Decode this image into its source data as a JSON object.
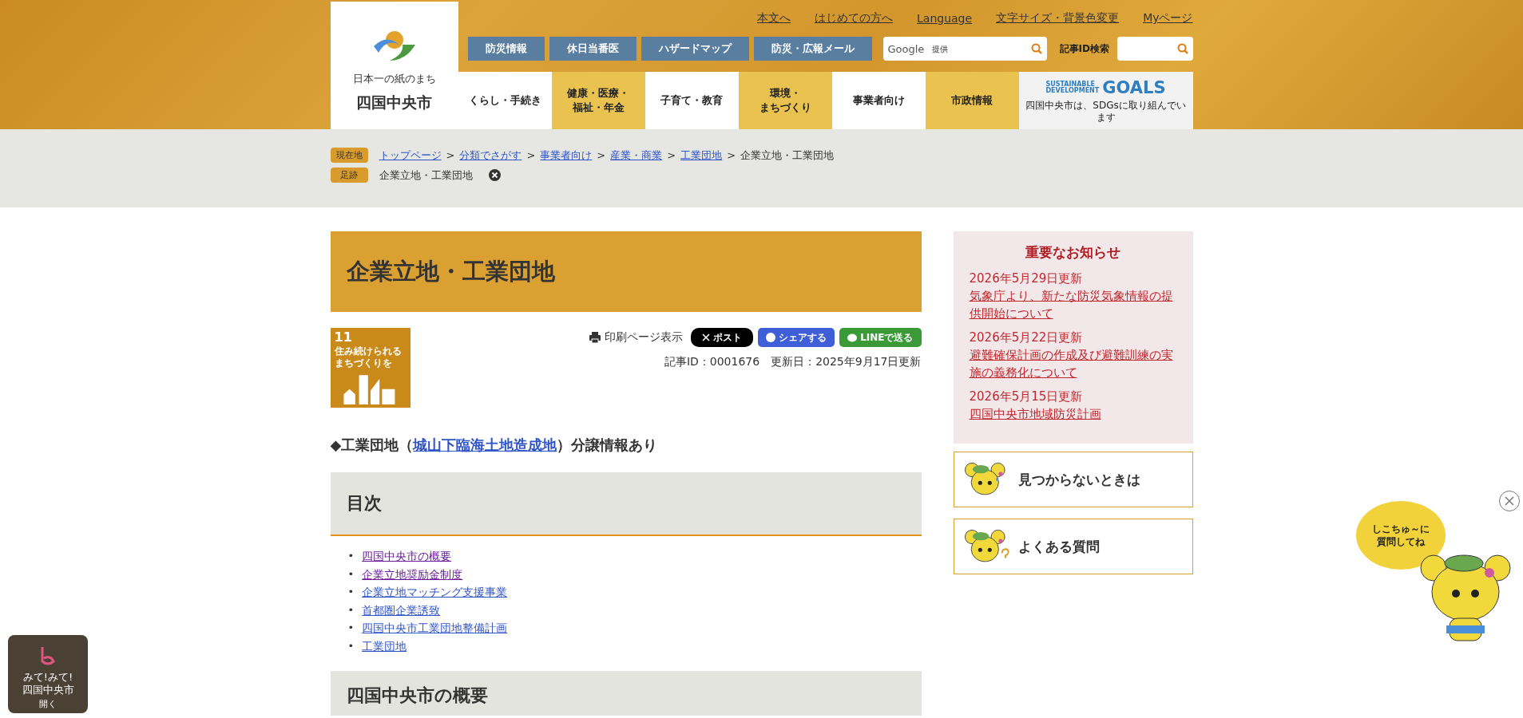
{
  "header": {
    "logo": {
      "tagline": "日本一の紙のまち",
      "name": "四国中央市"
    },
    "utility_links": [
      "本文へ",
      "はじめての方へ",
      "Language",
      "文字サイズ・背景色変更",
      "Myページ"
    ],
    "quick_buttons": [
      "防災情報",
      "休日当番医",
      "ハザードマップ",
      "防災・広報メール"
    ],
    "search": {
      "brand": "Google",
      "placeholder": "提供"
    },
    "id_search": {
      "label": "記事ID検索"
    },
    "global_nav": [
      {
        "lines": [
          "くらし・手続き"
        ],
        "color": "#ffffff"
      },
      {
        "lines": [
          "健康・医療・",
          "福祉・年金"
        ],
        "color": "#e9c24f"
      },
      {
        "lines": [
          "子育て・教育"
        ],
        "color": "#ffffff"
      },
      {
        "lines": [
          "環境・",
          "まちづくり"
        ],
        "color": "#e9c24f"
      },
      {
        "lines": [
          "事業者向け"
        ],
        "color": "#ffffff"
      },
      {
        "lines": [
          "市政情報"
        ],
        "color": "#e9c24f"
      }
    ],
    "sdgs_banner": {
      "line1": "SUSTAINABLE",
      "line2": "DEVELOPMENT",
      "goals": "GOALS",
      "caption": "四国中央市は、SDGsに取り組んでいます"
    }
  },
  "breadcrumb": {
    "label": "現在地",
    "items": [
      {
        "text": "トップページ",
        "link": true
      },
      {
        "text": "分類でさがす",
        "link": true
      },
      {
        "text": "事業者向け",
        "link": true
      },
      {
        "text": "産業・商業",
        "link": true
      },
      {
        "text": "工業団地",
        "link": true
      },
      {
        "text": "企業立地・工業団地",
        "link": false
      }
    ],
    "separator": ">"
  },
  "footprint": {
    "label": "足跡",
    "items": [
      "企業立地・工業団地"
    ]
  },
  "article": {
    "title": "企業立地・工業団地",
    "sdg_badge": {
      "number": "11",
      "lines": [
        "住み続けられる",
        "まちづくりを"
      ]
    },
    "print_label": "印刷ページ表示",
    "share_buttons": [
      {
        "kind": "x",
        "label": "ポスト"
      },
      {
        "kind": "facebook",
        "label": "シェアする"
      },
      {
        "kind": "line",
        "label": "LINEで送る"
      }
    ],
    "meta": "記事ID：0001676　更新日：2025年9月17日更新",
    "notice": {
      "before": "◆工業団地（",
      "link": "城山下臨海土地造成地",
      "after": "）分譲情報あり"
    },
    "toc": {
      "heading": "目次",
      "marker": "•",
      "items": [
        {
          "text": "四国中央市の概要",
          "visited": true
        },
        {
          "text": "企業立地奨励金制度",
          "visited": true
        },
        {
          "text": "企業立地マッチング支援事業",
          "visited": false
        },
        {
          "text": "首都圏企業誘致",
          "visited": false
        },
        {
          "text": "四国中央市工業団地整備計画",
          "visited": false
        },
        {
          "text": "工業団地",
          "visited": false
        }
      ]
    },
    "next_heading": "四国中央市の概要"
  },
  "sidebar": {
    "important": {
      "heading": "重要なお知らせ",
      "items": [
        {
          "date": "2026年5月29日更新",
          "link": "気象庁より、新たな防災気象情報の提供開始について"
        },
        {
          "date": "2026年5月22日更新",
          "link": "避難確保計画の作成及び避難訓練の実施の義務化について"
        },
        {
          "date": "2026年5月15日更新",
          "link": "四国中央市地域防災計画"
        }
      ]
    },
    "banners": [
      {
        "kind": "worried",
        "label": "見つからないときは"
      },
      {
        "kind": "question",
        "label": "よくある質問"
      }
    ]
  },
  "floating": {
    "left_widget": {
      "lines": [
        "みて!みて!",
        "四国中央市"
      ],
      "action": "開く"
    },
    "chat_balloon": {
      "lines": [
        "しこちゅ～に",
        "質問してね"
      ]
    }
  }
}
